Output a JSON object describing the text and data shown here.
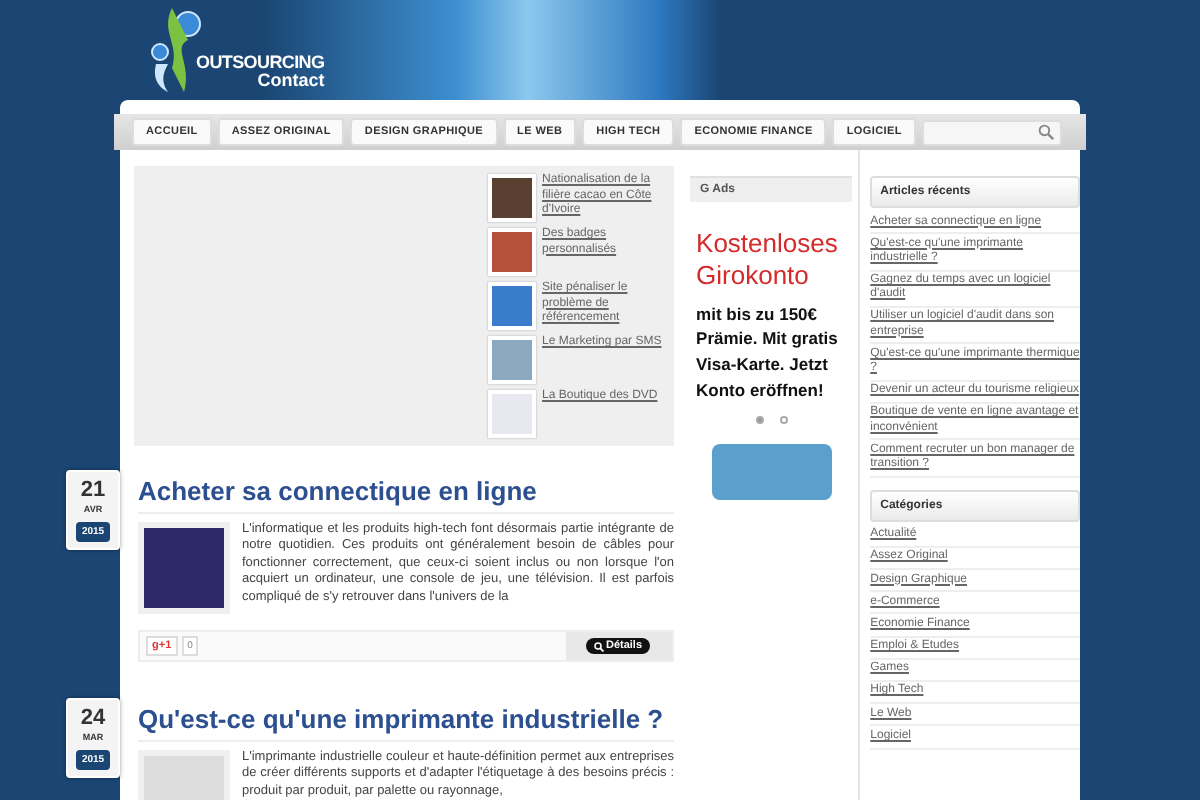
{
  "logo": {
    "line1": "OUTSOURCING",
    "line2": "Contact"
  },
  "nav": {
    "items": [
      {
        "label": "ACCUEIL"
      },
      {
        "label": "ASSEZ ORIGINAL"
      },
      {
        "label": "DESIGN GRAPHIQUE"
      },
      {
        "label": "LE WEB"
      },
      {
        "label": "HIGH TECH"
      },
      {
        "label": "ECONOMIE FINANCE"
      },
      {
        "label": "LOGICIEL"
      }
    ]
  },
  "related": [
    {
      "title": "Nationalisation de la filière cacao en Côte d'Ivoire"
    },
    {
      "title": "Des badges personnalisés"
    },
    {
      "title": "Site pénaliser le problème de référencement"
    },
    {
      "title": "Le Marketing par SMS"
    },
    {
      "title": "La Boutique des DVD"
    }
  ],
  "posts": [
    {
      "day": "21",
      "month": "AVR",
      "year": "2015",
      "title": "Acheter sa connectique en ligne",
      "excerpt": "L'informatique et les produits high-tech font désormais partie intégrante de notre quotidien. Ces produits ont généralement besoin de câbles pour fonctionner correctement, que ceux-ci soient inclus ou non lorsque l'on acquiert un ordinateur, une console de jeu, une télévision. Il est parfois compliqué de s'y retrouver dans l'univers de la",
      "plus": "g+1",
      "count": "0",
      "details": "Détails"
    },
    {
      "day": "24",
      "month": "MAR",
      "year": "2015",
      "title": "Qu'est-ce qu'une imprimante industrielle ?",
      "excerpt": "L'imprimante industrielle couleur et haute-définition permet aux entreprises de créer différents supports et d'adapter l'étiquetage à des besoins précis : produit par produit, par palette ou rayonnage,"
    }
  ],
  "ad": {
    "header": "G Ads",
    "headline": "Kostenloses Girokonto",
    "body": "mit bis zu 150€ Prämie. Mit gratis Visa-Karte. Jetzt Konto eröffnen!",
    "dots": [
      {
        "selected": true
      },
      {
        "selected": false
      }
    ]
  },
  "sidebar": [
    {
      "title": "Articles récents",
      "items": [
        "Acheter sa connectique en ligne",
        "Qu'est-ce qu'une imprimante industrielle ?",
        "Gagnez du temps avec un logiciel d'audit",
        "Utiliser un logiciel d'audit dans son entreprise",
        "Qu'est-ce qu'une imprimante thermique ?",
        "Devenir un acteur du tourisme religieux",
        "Boutique de vente en ligne avantage et inconvénient",
        "Comment recruter un bon manager de transition ?"
      ]
    },
    {
      "title": "Catégories",
      "items": [
        "Actualité",
        "Assez Original",
        "Design Graphique",
        "e-Commerce",
        "Economie Finance",
        "Emploi & Etudes",
        "Games",
        "High Tech",
        "Le Web",
        "Logiciel"
      ]
    }
  ]
}
